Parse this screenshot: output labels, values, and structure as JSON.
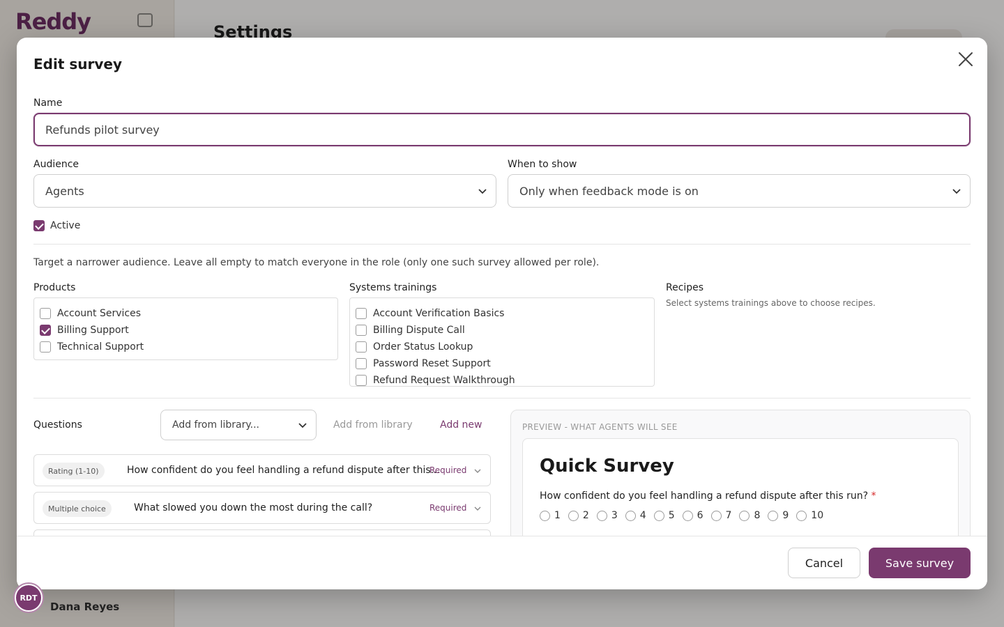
{
  "background": {
    "logo": "Reddy",
    "page_title": "Settings",
    "user_name": "Dana Reyes",
    "avatar_initials": "RDT"
  },
  "modal": {
    "title": "Edit survey",
    "name_label": "Name",
    "name_value": "Refunds pilot survey",
    "audience_label": "Audience",
    "audience_value": "Agents",
    "when_label": "When to show",
    "when_value": "Only when feedback mode is on",
    "active_label": "Active",
    "active_checked": true,
    "targeting_hint": "Target a narrower audience. Leave all empty to match everyone in the role (only one such survey allowed per role).",
    "products": {
      "label": "Products",
      "items": [
        {
          "label": "Account Services",
          "checked": false
        },
        {
          "label": "Billing Support",
          "checked": true
        },
        {
          "label": "Technical Support",
          "checked": false
        }
      ]
    },
    "trainings": {
      "label": "Systems trainings",
      "items": [
        {
          "label": "Account Verification Basics",
          "checked": false
        },
        {
          "label": "Billing Dispute Call",
          "checked": false
        },
        {
          "label": "Order Status Lookup",
          "checked": false
        },
        {
          "label": "Password Reset Support",
          "checked": false
        },
        {
          "label": "Refund Request Walkthrough",
          "checked": false
        }
      ]
    },
    "recipes": {
      "label": "Recipes",
      "note": "Select systems trainings above to choose recipes."
    },
    "questions": {
      "label": "Questions",
      "library_select": "Add from library...",
      "add_from_library": "Add from library",
      "add_new": "Add new",
      "items": [
        {
          "type": "Rating (1-10)",
          "text": "How confident do you feel handling a refund dispute after this run?",
          "required": "Required"
        },
        {
          "type": "Multiple choice",
          "text": "What slowed you down the most during the call?",
          "required": "Required"
        }
      ]
    },
    "preview": {
      "label": "PREVIEW - WHAT AGENTS WILL SEE",
      "title": "Quick Survey",
      "question": "How confident do you feel handling a refund dispute after this run?",
      "required_mark": "*",
      "options": [
        "1",
        "2",
        "3",
        "4",
        "5",
        "6",
        "7",
        "8",
        "9",
        "10"
      ]
    },
    "footer": {
      "cancel": "Cancel",
      "save": "Save survey"
    }
  },
  "colors": {
    "accent": "#7a3a6f",
    "required_star": "#d62a2a"
  }
}
